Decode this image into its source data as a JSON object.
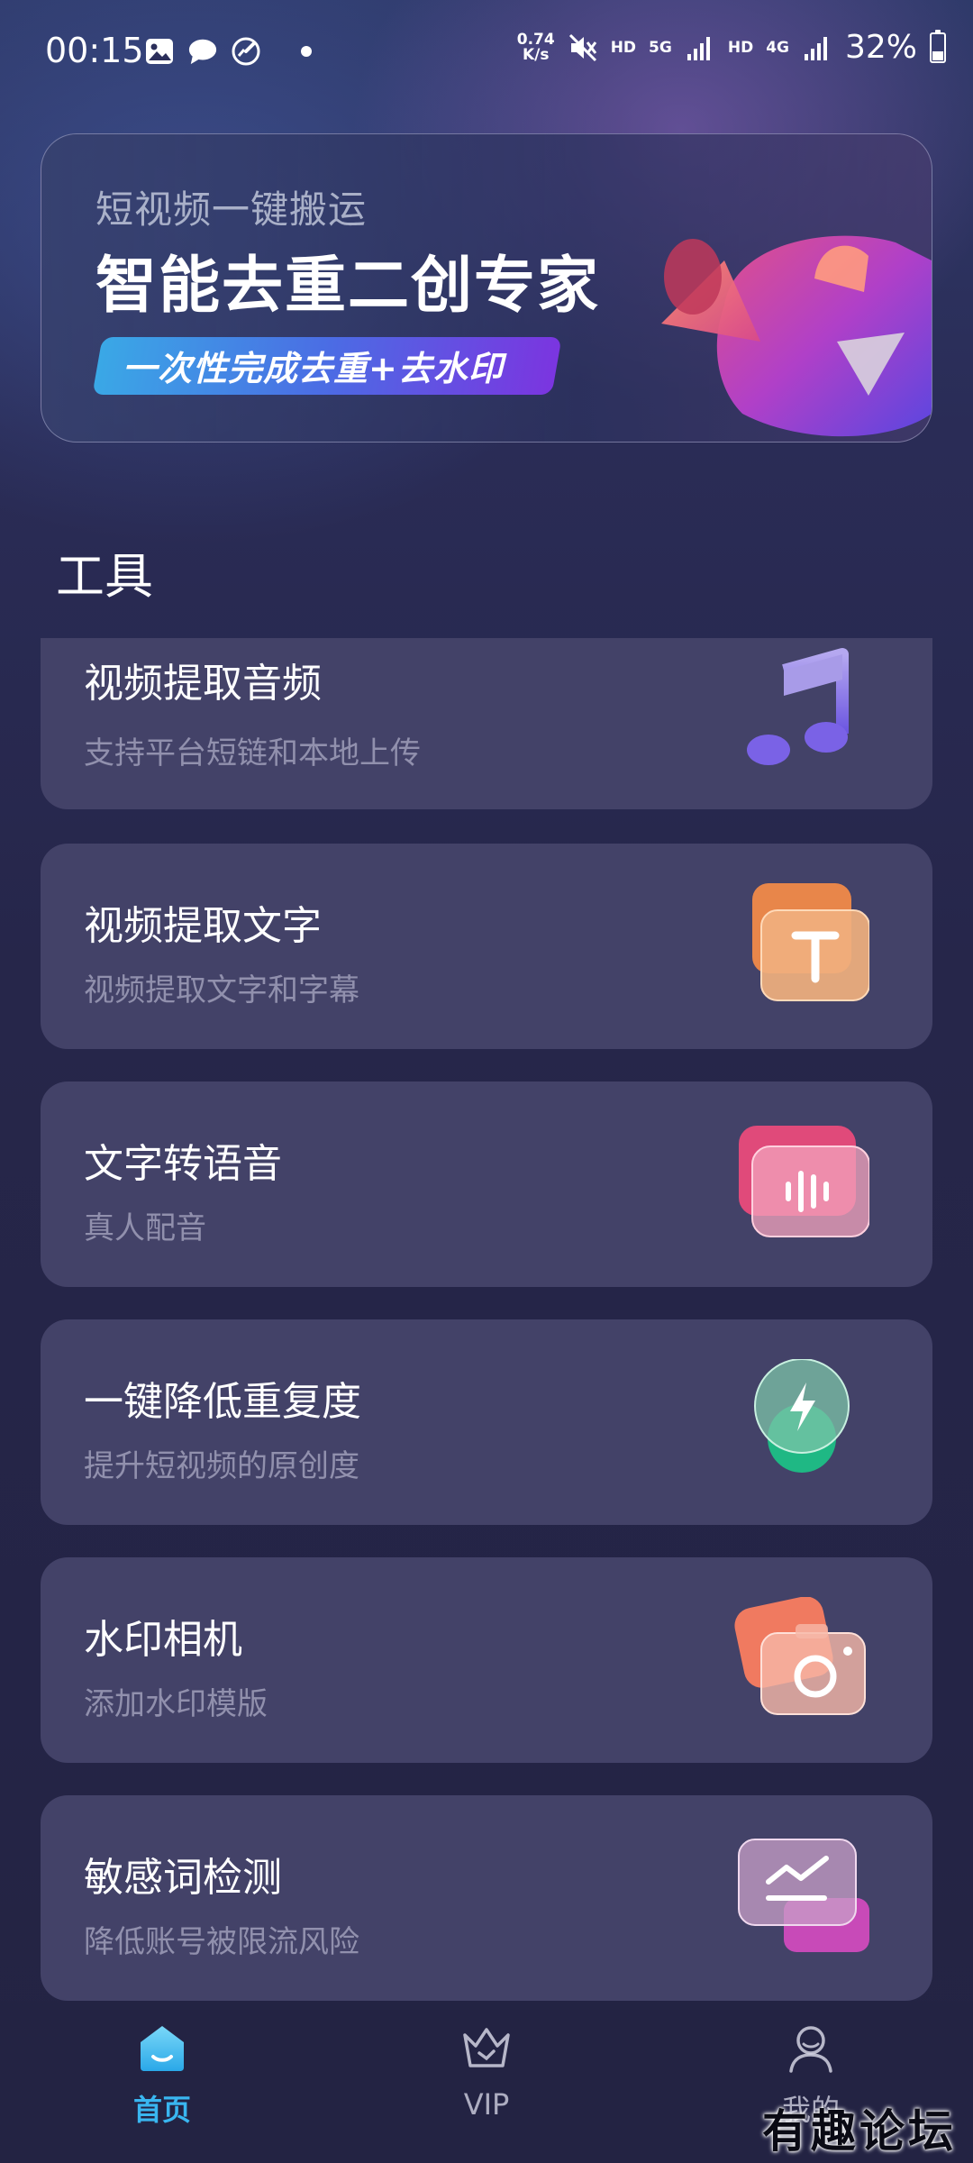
{
  "status_bar": {
    "time": "00:15",
    "speed_value": "0.74",
    "speed_unit": "K/s",
    "hd1": "HD",
    "net1": "5G",
    "hd2": "HD",
    "net2": "4G",
    "battery": "32%",
    "battery_level": 0.32
  },
  "banner": {
    "subtitle": "短视频一键搬运",
    "title": "智能去重二创专家",
    "pill": "一次性完成去重+去水印"
  },
  "section": {
    "title": "工具"
  },
  "tools": [
    {
      "title": "视频提取音频",
      "desc": "支持平台短链和本地上传",
      "icon": "music-note-icon"
    },
    {
      "title": "视频提取文字",
      "desc": "视频提取文字和字幕",
      "icon": "text-t-icon"
    },
    {
      "title": "文字转语音",
      "desc": "真人配音",
      "icon": "voice-wave-icon"
    },
    {
      "title": "一键降低重复度",
      "desc": "提升短视频的原创度",
      "icon": "lightning-icon"
    },
    {
      "title": "水印相机",
      "desc": "添加水印模版",
      "icon": "camera-icon"
    },
    {
      "title": "敏感词检测",
      "desc": "降低账号被限流风险",
      "icon": "trend-chart-icon"
    }
  ],
  "nav": {
    "home": "首页",
    "vip": "VIP",
    "me": "我的",
    "active_color": "#39b6f0"
  },
  "watermark": "有趣论坛"
}
